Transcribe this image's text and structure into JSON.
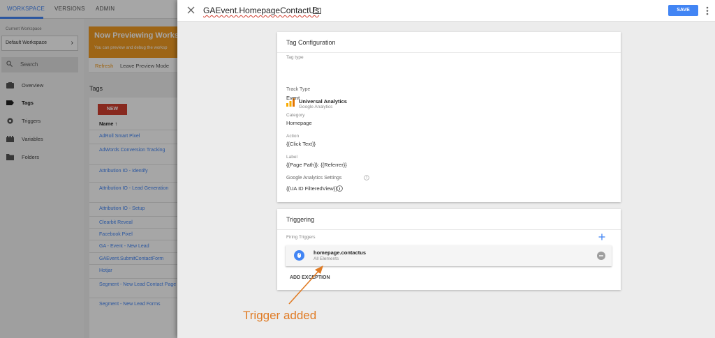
{
  "topnav": {
    "tabs": [
      {
        "label": "WORKSPACE"
      },
      {
        "label": "VERSIONS"
      },
      {
        "label": "ADMIN"
      }
    ]
  },
  "sidebar": {
    "current_workspace_label": "Current Workspace",
    "workspace_name": "Default Workspace",
    "search_label": "Search",
    "items": [
      {
        "label": "Overview",
        "icon": "overview-icon"
      },
      {
        "label": "Tags",
        "icon": "tag-icon"
      },
      {
        "label": "Triggers",
        "icon": "trigger-icon"
      },
      {
        "label": "Variables",
        "icon": "variables-icon"
      },
      {
        "label": "Folders",
        "icon": "folder-icon"
      }
    ]
  },
  "preview": {
    "title": "Now Previewing Workspa",
    "subtitle": "You can preview and debug the worksp",
    "refresh": "Refresh",
    "leave": "Leave Preview Mode"
  },
  "tags": {
    "heading": "Tags",
    "new_button": "NEW",
    "column_name": "Name ↑",
    "rows": [
      "AdRoll Smart Pixel",
      "AdWords Conversion Tracking",
      "Attribution IO - Identify",
      "Attribution IO - Lead Generation",
      "Attribution IO - Setup",
      "Clearbit Reveal",
      "Facebook Pixel",
      "GA - Event - New Lead",
      "GAEvent.SubmitContactForm",
      "Hotjar",
      "Segment - New Lead Contact Page",
      "Segment - New Lead Forms"
    ]
  },
  "panel": {
    "title": "GAEvent.HomepageContactUs",
    "save_label": "SAVE",
    "config": {
      "heading": "Tag Configuration",
      "tag_type_label": "Tag type",
      "tag_type_name": "Universal Analytics",
      "tag_type_vendor": "Google Analytics",
      "fields": [
        {
          "label": "Track Type",
          "value": "Event"
        },
        {
          "label": "Category",
          "value": "Homepage"
        },
        {
          "label": "Action",
          "value": "{{Click Text}}"
        },
        {
          "label": "Label",
          "value": "{{Page Path}}: {{Referrer}}"
        },
        {
          "label": "Google Analytics Settings",
          "value": "{{UA ID FilteredView}}"
        }
      ]
    },
    "triggering": {
      "heading": "Triggering",
      "firing_label": "Firing Triggers",
      "trigger_name": "homepage.contactus",
      "trigger_type": "All Elements",
      "add_exception": "ADD EXCEPTION"
    }
  },
  "annotation": {
    "text": "Trigger added",
    "color": "#e07b24"
  },
  "colors": {
    "accent": "#4285f4",
    "preview_orange": "#f29c22",
    "new_red": "#d23f31"
  }
}
